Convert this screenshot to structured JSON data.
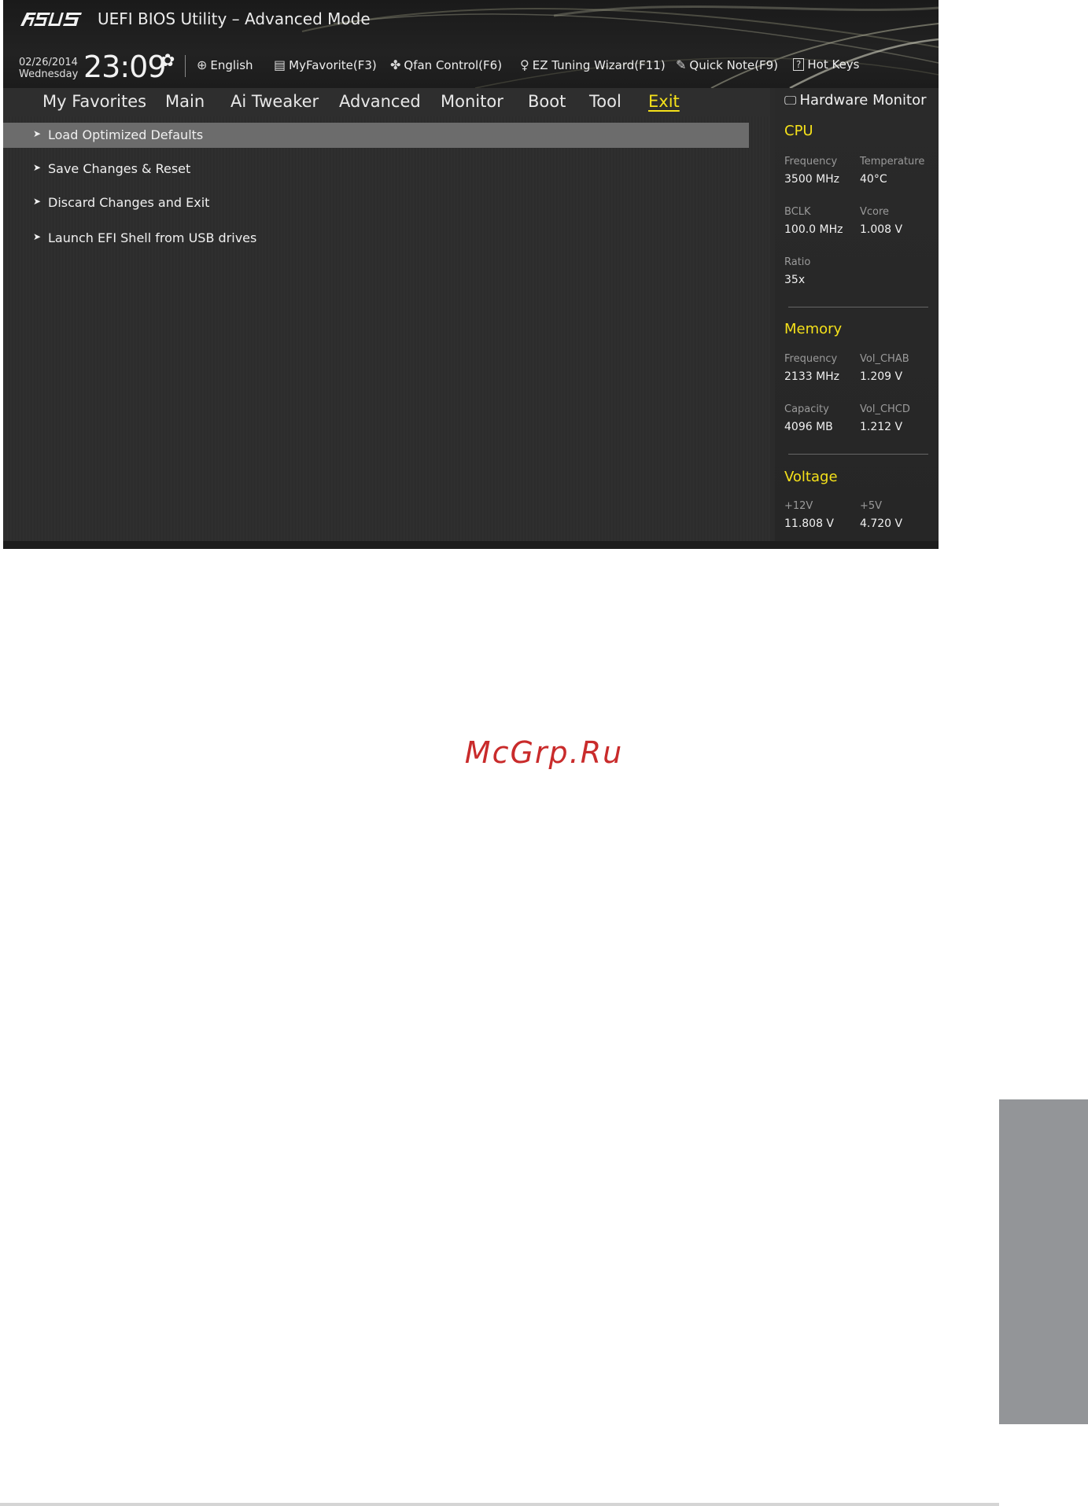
{
  "header": {
    "app_title": "UEFI BIOS Utility – Advanced Mode",
    "date": "02/26/2014",
    "weekday": "Wednesday",
    "time": "23:09",
    "tools": [
      {
        "label": "English",
        "icon": "globe-icon"
      },
      {
        "label": "MyFavorite(F3)",
        "icon": "favorite-list-icon"
      },
      {
        "label": "Qfan Control(F6)",
        "icon": "fan-icon"
      },
      {
        "label": "EZ Tuning Wizard(F11)",
        "icon": "lightbulb-icon"
      },
      {
        "label": "Quick Note(F9)",
        "icon": "note-icon"
      },
      {
        "label": "Hot Keys",
        "icon": "question-icon"
      }
    ]
  },
  "nav": {
    "tabs": [
      "My Favorites",
      "Main",
      "Ai Tweaker",
      "Advanced",
      "Monitor",
      "Boot",
      "Tool",
      "Exit"
    ],
    "active": "Exit"
  },
  "menu": {
    "items": [
      "Load Optimized Defaults",
      "Save Changes & Reset",
      "Discard Changes and Exit",
      "Launch EFI Shell from USB drives"
    ],
    "selected": "Load Optimized Defaults"
  },
  "hardware_monitor": {
    "title": "Hardware Monitor",
    "cpu": {
      "heading": "CPU",
      "frequency_label": "Frequency",
      "frequency": "3500 MHz",
      "temperature_label": "Temperature",
      "temperature": "40°C",
      "bclk_label": "BCLK",
      "bclk": "100.0 MHz",
      "vcore_label": "Vcore",
      "vcore": "1.008 V",
      "ratio_label": "Ratio",
      "ratio": "35x"
    },
    "memory": {
      "heading": "Memory",
      "frequency_label": "Frequency",
      "frequency": "2133 MHz",
      "vol_chab_label": "Vol_CHAB",
      "vol_chab": "1.209 V",
      "capacity_label": "Capacity",
      "capacity": "4096 MB",
      "vol_chcd_label": "Vol_CHCD",
      "vol_chcd": "1.212 V"
    },
    "voltage": {
      "heading": "Voltage",
      "v12_label": "+12V",
      "v12": "11.808 V",
      "v5_label": "+5V",
      "v5": "4.720 V"
    }
  },
  "watermark": "McGrp.Ru",
  "colors": {
    "accent": "#f5e11a",
    "selected_row": "#6c6c6c",
    "watermark": "#c92b2b",
    "side_tab": "#939598"
  }
}
